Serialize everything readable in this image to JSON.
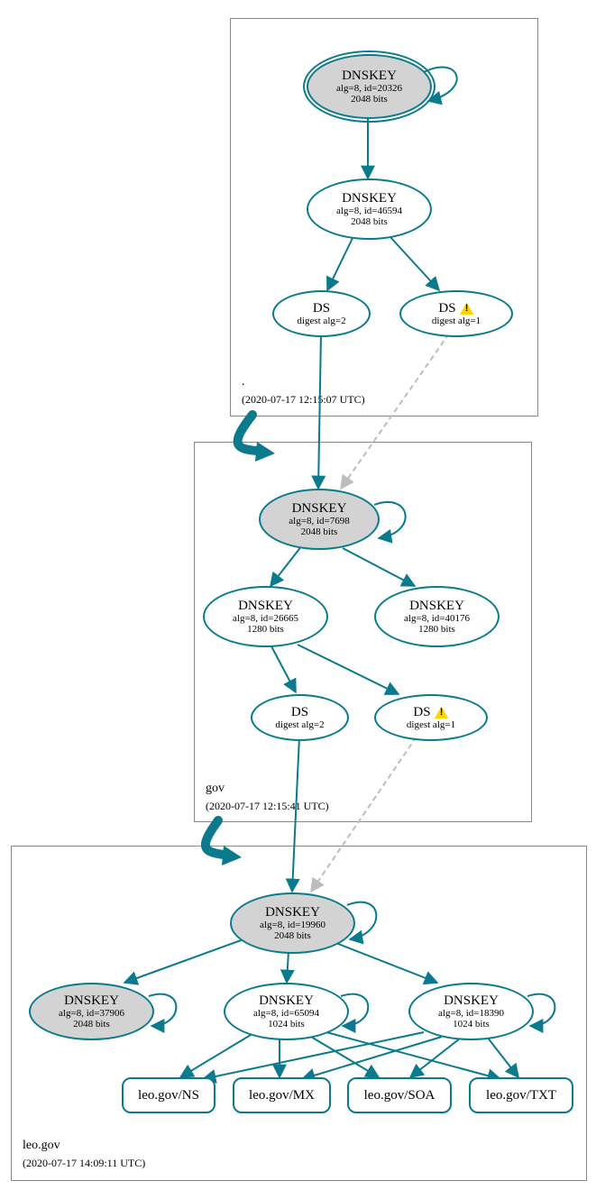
{
  "chart_data": {
    "type": "graph",
    "zones": [
      {
        "name": ".",
        "timestamp": "(2020-07-17 12:15:07 UTC)",
        "nodes": [
          {
            "id": "root-ksk",
            "label": "DNSKEY",
            "detail": "alg=8, id=20326",
            "bits": "2048 bits",
            "ksk": true,
            "trust_anchor": true
          },
          {
            "id": "root-zsk",
            "label": "DNSKEY",
            "detail": "alg=8, id=46594",
            "bits": "2048 bits"
          },
          {
            "id": "root-ds2",
            "label": "DS",
            "detail": "digest alg=2"
          },
          {
            "id": "root-ds1",
            "label": "DS",
            "detail": "digest alg=1",
            "warn": true
          }
        ],
        "edges": [
          [
            "root-ksk",
            "root-ksk",
            "self"
          ],
          [
            "root-ksk",
            "root-zsk",
            "solid"
          ],
          [
            "root-zsk",
            "root-ds2",
            "solid"
          ],
          [
            "root-zsk",
            "root-ds1",
            "solid"
          ]
        ]
      },
      {
        "name": "gov",
        "timestamp": "(2020-07-17 12:15:41 UTC)",
        "nodes": [
          {
            "id": "gov-ksk",
            "label": "DNSKEY",
            "detail": "alg=8, id=7698",
            "bits": "2048 bits",
            "ksk": true
          },
          {
            "id": "gov-zsk1",
            "label": "DNSKEY",
            "detail": "alg=8, id=26665",
            "bits": "1280 bits"
          },
          {
            "id": "gov-zsk2",
            "label": "DNSKEY",
            "detail": "alg=8, id=40176",
            "bits": "1280 bits"
          },
          {
            "id": "gov-ds2",
            "label": "DS",
            "detail": "digest alg=2"
          },
          {
            "id": "gov-ds1",
            "label": "DS",
            "detail": "digest alg=1",
            "warn": true
          }
        ],
        "edges": [
          [
            "root-ds2",
            "gov-ksk",
            "solid"
          ],
          [
            "root-ds1",
            "gov-ksk",
            "dashed"
          ],
          [
            "gov-ksk",
            "gov-ksk",
            "self"
          ],
          [
            "gov-ksk",
            "gov-zsk1",
            "solid"
          ],
          [
            "gov-ksk",
            "gov-zsk2",
            "solid"
          ],
          [
            "gov-zsk1",
            "gov-ds2",
            "solid"
          ],
          [
            "gov-zsk1",
            "gov-ds1",
            "solid"
          ]
        ]
      },
      {
        "name": "leo.gov",
        "timestamp": "(2020-07-17 14:09:11 UTC)",
        "nodes": [
          {
            "id": "leo-ksk",
            "label": "DNSKEY",
            "detail": "alg=8, id=19960",
            "bits": "2048 bits",
            "ksk": true
          },
          {
            "id": "leo-k2",
            "label": "DNSKEY",
            "detail": "alg=8, id=37906",
            "bits": "2048 bits",
            "gray": true
          },
          {
            "id": "leo-zsk1",
            "label": "DNSKEY",
            "detail": "alg=8, id=65094",
            "bits": "1024 bits"
          },
          {
            "id": "leo-zsk2",
            "label": "DNSKEY",
            "detail": "alg=8, id=18390",
            "bits": "1024 bits"
          },
          {
            "id": "leo-ns",
            "label": "leo.gov/NS"
          },
          {
            "id": "leo-mx",
            "label": "leo.gov/MX"
          },
          {
            "id": "leo-soa",
            "label": "leo.gov/SOA"
          },
          {
            "id": "leo-txt",
            "label": "leo.gov/TXT"
          }
        ],
        "edges": [
          [
            "gov-ds2",
            "leo-ksk",
            "solid"
          ],
          [
            "gov-ds1",
            "leo-ksk",
            "dashed"
          ],
          [
            "leo-ksk",
            "leo-ksk",
            "self"
          ],
          [
            "leo-ksk",
            "leo-k2",
            "solid"
          ],
          [
            "leo-k2",
            "leo-k2",
            "self"
          ],
          [
            "leo-ksk",
            "leo-zsk1",
            "solid"
          ],
          [
            "leo-zsk1",
            "leo-zsk1",
            "self"
          ],
          [
            "leo-ksk",
            "leo-zsk2",
            "solid"
          ],
          [
            "leo-zsk2",
            "leo-zsk2",
            "self"
          ],
          [
            "leo-zsk1",
            "leo-ns",
            "solid"
          ],
          [
            "leo-zsk1",
            "leo-mx",
            "solid"
          ],
          [
            "leo-zsk1",
            "leo-soa",
            "solid"
          ],
          [
            "leo-zsk1",
            "leo-txt",
            "solid"
          ],
          [
            "leo-zsk2",
            "leo-ns",
            "solid"
          ],
          [
            "leo-zsk2",
            "leo-mx",
            "solid"
          ],
          [
            "leo-zsk2",
            "leo-soa",
            "solid"
          ],
          [
            "leo-zsk2",
            "leo-txt",
            "solid"
          ]
        ]
      }
    ],
    "zone_transitions": [
      {
        "from": ".",
        "to": "gov"
      },
      {
        "from": "gov",
        "to": "leo.gov"
      }
    ]
  },
  "colors": {
    "stroke": "#0a7a8c",
    "dashed": "#bdbdbd"
  },
  "zones": {
    "root": {
      "name": ".",
      "ts": "(2020-07-17 12:15:07 UTC)"
    },
    "gov": {
      "name": "gov",
      "ts": "(2020-07-17 12:15:41 UTC)"
    },
    "leo": {
      "name": "leo.gov",
      "ts": "(2020-07-17 14:09:11 UTC)"
    }
  },
  "nodes": {
    "root_ksk": {
      "title": "DNSKEY",
      "sub1": "alg=8, id=20326",
      "sub2": "2048 bits"
    },
    "root_zsk": {
      "title": "DNSKEY",
      "sub1": "alg=8, id=46594",
      "sub2": "2048 bits"
    },
    "root_ds2": {
      "title": "DS",
      "sub1": "digest alg=2"
    },
    "root_ds1": {
      "title": "DS",
      "sub1": "digest alg=1"
    },
    "gov_ksk": {
      "title": "DNSKEY",
      "sub1": "alg=8, id=7698",
      "sub2": "2048 bits"
    },
    "gov_zsk1": {
      "title": "DNSKEY",
      "sub1": "alg=8, id=26665",
      "sub2": "1280 bits"
    },
    "gov_zsk2": {
      "title": "DNSKEY",
      "sub1": "alg=8, id=40176",
      "sub2": "1280 bits"
    },
    "gov_ds2": {
      "title": "DS",
      "sub1": "digest alg=2"
    },
    "gov_ds1": {
      "title": "DS",
      "sub1": "digest alg=1"
    },
    "leo_ksk": {
      "title": "DNSKEY",
      "sub1": "alg=8, id=19960",
      "sub2": "2048 bits"
    },
    "leo_k2": {
      "title": "DNSKEY",
      "sub1": "alg=8, id=37906",
      "sub2": "2048 bits"
    },
    "leo_zsk1": {
      "title": "DNSKEY",
      "sub1": "alg=8, id=65094",
      "sub2": "1024 bits"
    },
    "leo_zsk2": {
      "title": "DNSKEY",
      "sub1": "alg=8, id=18390",
      "sub2": "1024 bits"
    },
    "leo_ns": {
      "title": "leo.gov/NS"
    },
    "leo_mx": {
      "title": "leo.gov/MX"
    },
    "leo_soa": {
      "title": "leo.gov/SOA"
    },
    "leo_txt": {
      "title": "leo.gov/TXT"
    }
  }
}
